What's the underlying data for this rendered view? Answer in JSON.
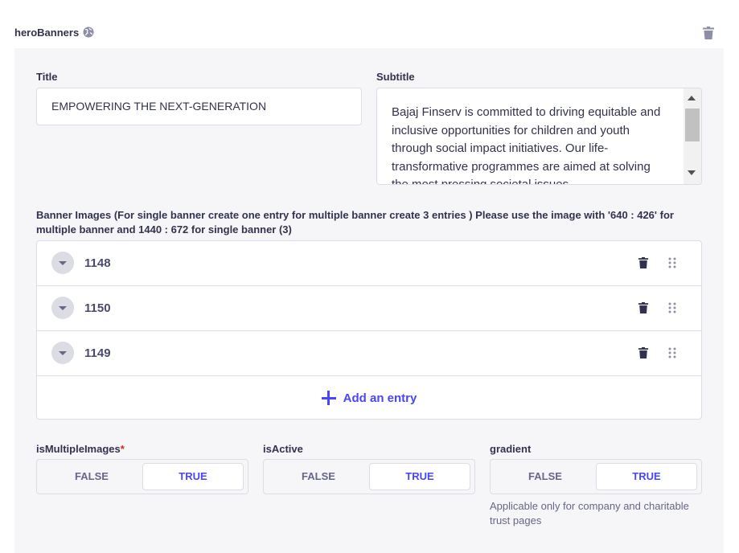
{
  "component": {
    "name": "heroBanners"
  },
  "fields": {
    "title": {
      "label": "Title",
      "value": "EMPOWERING THE NEXT-GENERATION"
    },
    "subtitle": {
      "label": "Subtitle",
      "value": "Bajaj Finserv is committed to driving equitable and inclusive opportunities for children and youth through social impact initiatives. Our life-transformative programmes are aimed at solving the most pressing societal issues"
    },
    "banner_images": {
      "label": "Banner Images (For single banner create one entry for multiple banner create 3 entries ) Please use the image with '640 : 426' for multiple banner and 1440 : 672 for single banner (3)",
      "entries": [
        "1148",
        "1150",
        "1149"
      ],
      "add_label": "Add an entry"
    },
    "is_multiple_images": {
      "label": "isMultipleImages",
      "required_mark": "*",
      "false_label": "FALSE",
      "true_label": "TRUE",
      "selected": "TRUE"
    },
    "is_active": {
      "label": "isActive",
      "false_label": "FALSE",
      "true_label": "TRUE",
      "selected": "TRUE"
    },
    "gradient": {
      "label": "gradient",
      "false_label": "FALSE",
      "true_label": "TRUE",
      "selected": "TRUE",
      "hint": "Applicable only for company and charitable trust pages"
    }
  },
  "icons": {
    "header_info": "globe-icon",
    "delete": "trash-icon",
    "collapse": "chevron-down-icon",
    "reorder": "drag-icon",
    "add": "plus-icon"
  },
  "colors": {
    "accent": "#4945ff",
    "panel_bg": "#f6f6f9",
    "border": "#dcdce4",
    "required": "#d02b20"
  }
}
